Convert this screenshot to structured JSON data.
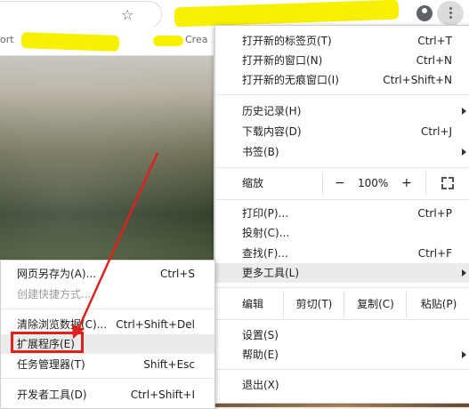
{
  "toolbar": {
    "star_icon": "star-icon",
    "profile_icon": "account-circle-icon",
    "menu_icon": "more-vert-icon",
    "bookmark_fragment_left": "ort",
    "bookmark_fragment_right": "Crea"
  },
  "main_menu": {
    "items": [
      {
        "label": "打开新的标签页(T)",
        "shortcut": "Ctrl+T"
      },
      {
        "label": "打开新的窗口(N)",
        "shortcut": "Ctrl+N"
      },
      {
        "label": "打开新的无痕窗口(I)",
        "shortcut": "Ctrl+Shift+N"
      },
      {
        "label": "历史记录(H)",
        "shortcut": ""
      },
      {
        "label": "下载内容(D)",
        "shortcut": "Ctrl+J"
      },
      {
        "label": "书签(B)",
        "shortcut": ""
      },
      {
        "label": "打印(P)...",
        "shortcut": "Ctrl+P"
      },
      {
        "label": "投射(C)...",
        "shortcut": ""
      },
      {
        "label": "查找(F)...",
        "shortcut": "Ctrl+F"
      },
      {
        "label": "更多工具(L)",
        "shortcut": ""
      },
      {
        "label": "设置(S)",
        "shortcut": ""
      },
      {
        "label": "帮助(E)",
        "shortcut": ""
      },
      {
        "label": "退出(X)",
        "shortcut": ""
      }
    ],
    "zoom": {
      "label": "缩放",
      "minus": "−",
      "value": "100%",
      "plus": "+"
    },
    "edit": {
      "label": "编辑",
      "cut": "剪切(T)",
      "copy": "复制(C)",
      "paste": "粘贴(P)"
    }
  },
  "sub_menu": {
    "items": [
      {
        "label": "网页另存为(A)...",
        "shortcut": "Ctrl+S"
      },
      {
        "label": "创建快捷方式...",
        "shortcut": ""
      },
      {
        "label": "清除浏览数据(C)...",
        "shortcut": "Ctrl+Shift+Del"
      },
      {
        "label": "扩展程序(E)",
        "shortcut": ""
      },
      {
        "label": "任务管理器(T)",
        "shortcut": "Shift+Esc"
      },
      {
        "label": "开发者工具(D)",
        "shortcut": "Ctrl+Shift+I"
      }
    ]
  },
  "colors": {
    "annotation": "#e0201a",
    "highlight_marker": "#f7f000"
  }
}
